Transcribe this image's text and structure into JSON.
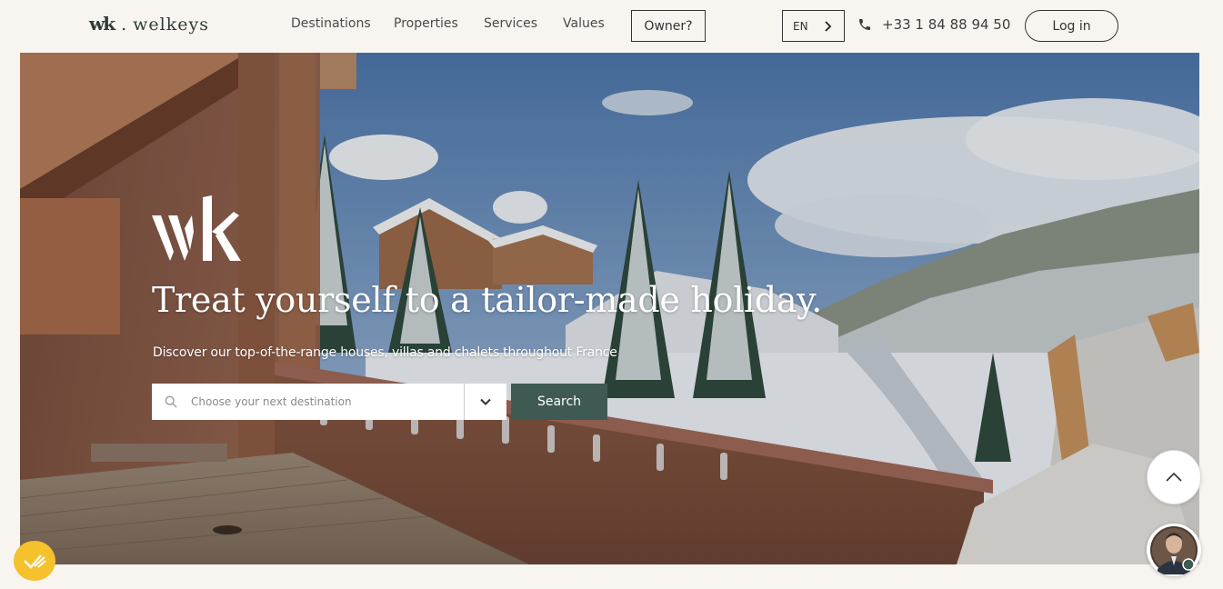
{
  "brand": {
    "mark": "wk",
    "separator": ".",
    "name": "welkeys"
  },
  "nav": {
    "links": [
      {
        "label": "Destinations"
      },
      {
        "label": "Properties"
      },
      {
        "label": "Services"
      },
      {
        "label": "Values"
      }
    ],
    "owner_label": "Owner?",
    "language": "EN",
    "phone": "+33 1 84 88 94 50",
    "login_label": "Log in"
  },
  "hero": {
    "title": "Treat yourself to a tailor-made holiday.",
    "subtitle": "Discover our top-of-the-range houses, villas and chalets throughout France",
    "search": {
      "placeholder": "Choose your next destination",
      "button_label": "Search"
    }
  },
  "colors": {
    "background": "#f8f5f0",
    "accent_green": "#3f5a52",
    "cookie_yellow": "#f5c12c",
    "text_dark": "#333333"
  },
  "icons": {
    "phone": "phone-icon",
    "lang_arrow": "chevron-right-icon",
    "search": "search-icon",
    "dropdown": "chevron-down-icon",
    "scroll_top": "chevron-up-icon",
    "cookie": "cookie-consent-icon"
  }
}
